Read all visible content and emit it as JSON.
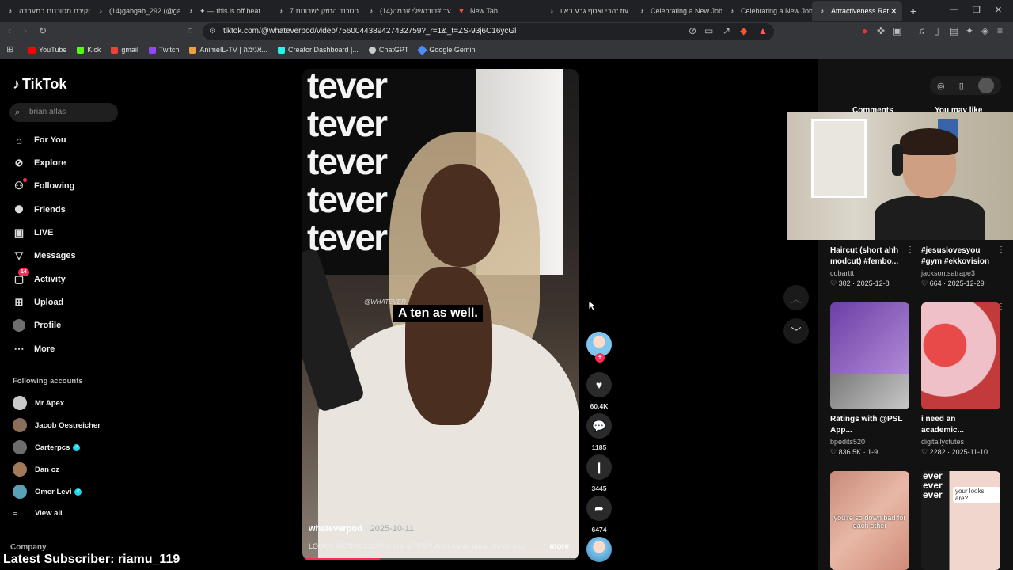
{
  "browser": {
    "tabs": [
      {
        "label": "חקירת מסוכנות במעבדה"
      },
      {
        "label": "(14)gabgab_292 (@gal"
      },
      {
        "label": "✦ — this is off beat"
      },
      {
        "label": "הטרנד החזק *שבונות 7"
      },
      {
        "label": "(14)שיער #דודהשלי #במה"
      },
      {
        "label": "New Tab"
      },
      {
        "label": "עוז זהבי ואסף גבע באוו"
      },
      {
        "label": "Celebrating a New Job"
      },
      {
        "label": "Celebrating a New Job"
      },
      {
        "label": "Attractiveness Rat"
      }
    ],
    "url": "tiktok.com/@whateverpod/video/7560044389427432759?_r=1&_t=ZS-93j6C16ycGl",
    "bookmarks": [
      {
        "label": "YouTube",
        "color": "#ff0000"
      },
      {
        "label": "Kick",
        "color": "#53fc18"
      },
      {
        "label": "gmail",
        "color": "#ea4335"
      },
      {
        "label": "Twitch",
        "color": "#9146ff"
      },
      {
        "label": "AnimeIL-TV | אנימה...",
        "color": "#f0a040"
      },
      {
        "label": "Creator Dashboard |...",
        "color": "#25f4ee"
      },
      {
        "label": "ChatGPT",
        "color": "#cccccc"
      },
      {
        "label": "Google Gemini",
        "color": "#4e8cf7"
      }
    ]
  },
  "sidebar": {
    "logo": "TikTok",
    "search_placeholder": "brian atlas",
    "nav": [
      {
        "label": "For You",
        "icon": "home-icon"
      },
      {
        "label": "Explore",
        "icon": "compass-icon"
      },
      {
        "label": "Following",
        "icon": "following-icon"
      },
      {
        "label": "Friends",
        "icon": "friends-icon"
      },
      {
        "label": "LIVE",
        "icon": "live-icon"
      },
      {
        "label": "Messages",
        "icon": "messages-icon"
      },
      {
        "label": "Activity",
        "icon": "activity-icon",
        "badge": "14"
      },
      {
        "label": "Upload",
        "icon": "upload-icon"
      },
      {
        "label": "Profile",
        "icon": "profile-icon"
      },
      {
        "label": "More",
        "icon": "more-icon"
      }
    ],
    "following_title": "Following accounts",
    "accounts": [
      {
        "name": "Mr Apex",
        "color": "#c9c9c9",
        "verified": false
      },
      {
        "name": "Jacob Oestreicher",
        "color": "#8a6e5a",
        "verified": false
      },
      {
        "name": "Carterpcs",
        "color": "#6d6d6d",
        "verified": true
      },
      {
        "name": "Dan oz",
        "color": "#a07a5a",
        "verified": false
      },
      {
        "name": "Omer Levi",
        "color": "#5aa0b8",
        "verified": true
      }
    ],
    "view_all": "View all",
    "company": "Company"
  },
  "video": {
    "wall_text": "tever",
    "caption": "A ten as well.",
    "watermark": "@WHATEVER",
    "username": "whateverpod",
    "date": "· 2025-10-11",
    "description": "LOOKS RATING 1-10?! Is she a TEN?! Are they as attractive as they",
    "more": "more",
    "progress": 0.28
  },
  "actions": {
    "likes": "60.4K",
    "comments": "1185",
    "saves": "3445",
    "shares": "6474"
  },
  "right_panel": {
    "tabs": [
      "Comments",
      "You may like"
    ],
    "cards": [
      {
        "title": "Haircut (short ahh modcut) #fembo...",
        "author": "cobarttt",
        "likes": "302",
        "date": "2025-12-8"
      },
      {
        "title": "#jesuslovesyou #gym #ekkovision",
        "author": "jackson.satrape3",
        "likes": "664",
        "date": "2025-12-29"
      },
      {
        "title": "Ratings with @PSL App...",
        "author": "bpedits520",
        "likes": "836.5K",
        "date": "1-9"
      },
      {
        "title": "i need an academic...",
        "author": "digitallyctutes",
        "likes": "2282",
        "date": "2025-11-10"
      },
      {
        "title": "",
        "author": "",
        "likes": "",
        "date": "",
        "overlay": "you're so down bad for each other"
      },
      {
        "title": "",
        "author": "",
        "likes": "",
        "date": "",
        "overlay": "your looks are?"
      }
    ],
    "thumb_overlay_3": "ever\never\never"
  },
  "stream": {
    "latest_subscriber": "Latest Subscriber: riamu_119"
  }
}
